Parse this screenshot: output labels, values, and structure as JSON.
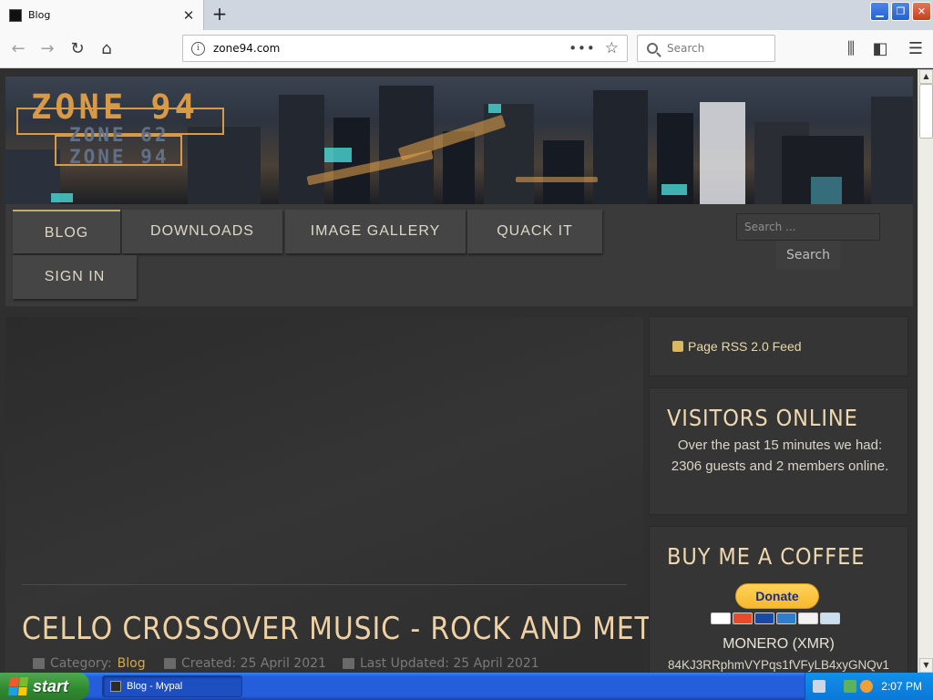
{
  "browser": {
    "tab_title": "Blog",
    "close_glyph": "✕",
    "new_tab_glyph": "+",
    "window_buttons": {
      "minimize": "▁",
      "maximize": "❐",
      "close": "✕"
    },
    "url": "zone94.com",
    "url_info_glyph": "i",
    "url_more": "•••",
    "url_star": "☆",
    "search_placeholder": "Search",
    "icons": {
      "back": "←",
      "forward": "→",
      "reload": "↻",
      "home": "⌂",
      "library": "⫼",
      "sidebar": "◧",
      "menu": "☰"
    }
  },
  "site": {
    "logo": {
      "main": "ZONE 94",
      "sub1": "ZONE 62",
      "sub2": "ZONE 94"
    },
    "menu": [
      {
        "label": "BLOG",
        "active": true
      },
      {
        "label": "DOWNLOADS"
      },
      {
        "label": "IMAGE GALLERY"
      },
      {
        "label": "QUACK IT"
      },
      {
        "label": "SIGN IN"
      }
    ],
    "search": {
      "placeholder": "Search ...",
      "button": "Search"
    }
  },
  "article": {
    "title": "CELLO CROSSOVER MUSIC - ROCK AND METAL",
    "category_label": "Category:",
    "category": "Blog",
    "created": "Created: 25 April 2021",
    "updated": "Last Updated: 25 April 2021"
  },
  "sidebar": {
    "rss": "Page RSS 2.0 Feed",
    "visitors": {
      "heading": "VISITORS ONLINE",
      "text": "Over the past 15 minutes we had: 2306 guests and 2 members online."
    },
    "coffee": {
      "heading": "BUY ME A COFFEE",
      "donate": "Donate",
      "currency": "MONERO (XMR)",
      "address": "84KJ3RRphmVYPqs1fVFyLB4xyGNQv1"
    }
  },
  "taskbar": {
    "start": "start",
    "task": "Blog - Mypal",
    "clock": "2:07 PM"
  },
  "colors": {
    "accent_gold": "#d6a947",
    "heading_cream": "#eed2a6",
    "paypal_yellow": "#f7b92d",
    "xp_blue": "#245edb",
    "xp_green": "#308a30"
  }
}
